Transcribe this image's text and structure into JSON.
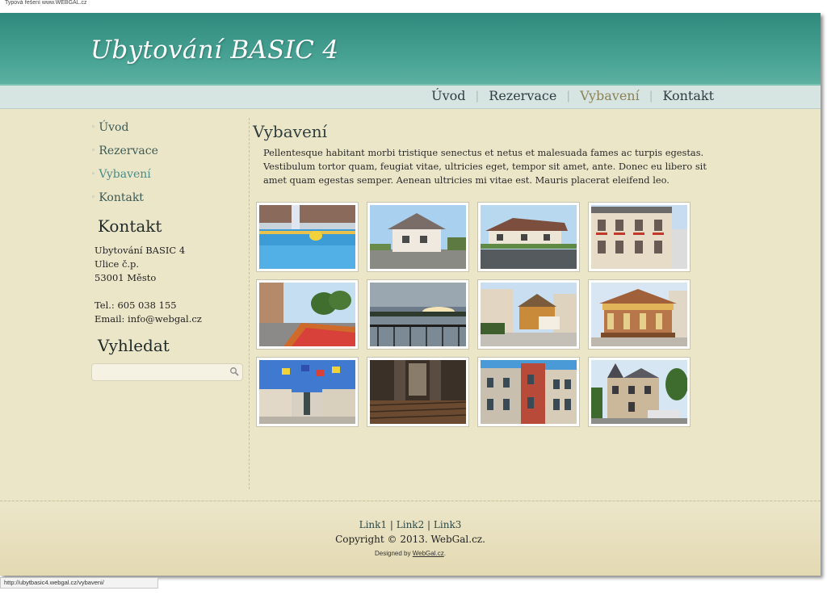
{
  "top_banner": "Typová řešení www.WEBGAL.cz",
  "site_title": "Ubytování BASIC 4",
  "nav": [
    "Úvod",
    "Rezervace",
    "Vybavení",
    "Kontakt"
  ],
  "sidebar": {
    "menu": [
      "Úvod",
      "Rezervace",
      "Vybavení",
      "Kontakt"
    ],
    "contact_heading": "Kontakt",
    "contact_lines": [
      "Ubytování BASIC 4",
      "Ulice č.p.",
      "53001 Město"
    ],
    "phone": "Tel.: 605 038 155",
    "email": "Email: info@webgal.cz",
    "search_heading": "Vyhledat",
    "search_value": "",
    "search_placeholder": ""
  },
  "content": {
    "title": "Vybavení",
    "paragraph": "Pellentesque habitant morbi tristique senectus et netus et malesuada fames ac turpis egestas. Vestibulum tortor quam, feugiat vitae, ultricies eget, tempor sit amet, ante. Donec eu libero sit amet quam egestas semper. Aenean ultricies mi vitae est. Mauris placerat eleifend leo."
  },
  "footer": {
    "link1": "Link1",
    "link2": "Link2",
    "link3": "Link3",
    "sep": "|",
    "copyright": "Copyright © 2013. WebGal.cz.",
    "designed_prefix": "Designed by",
    "designed_link": "WebGal.cz",
    "designed_suffix": "."
  },
  "status_url": "http://ubytbasic4.webgal.cz/vybaveni/",
  "colors": {
    "header": "#4aa596",
    "navbar": "#d6e4e2",
    "page_bg": "#ece6c9",
    "nav_active": "#8b8256",
    "sidebar_active": "#4a8c86"
  }
}
